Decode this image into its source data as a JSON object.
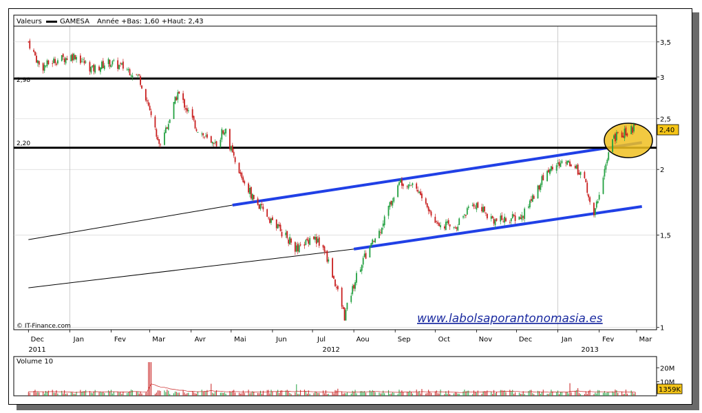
{
  "header": {
    "label": "Valeurs",
    "ticker": "GAMESA",
    "info": "Année +Bas: 1,60 +Haut: 2,43"
  },
  "credit": "© IT-Finance.com",
  "watermark": "www.labolsaporantonomasia.es",
  "volume_label": "Volume 10",
  "colors": {
    "up": "#22a040",
    "down": "#c81e1e",
    "trendline_blue": "#2040e6",
    "level_line": "#000000",
    "highlight_fill": "#f0c020",
    "price_badge": "#f5c518",
    "watermark": "#1a2aa0"
  },
  "chart_data": [
    {
      "type": "candlestick",
      "ticker": "GAMESA",
      "yscale": "log",
      "ylim": [
        0.99,
        3.75
      ],
      "y_ticks": [
        "3,5",
        "3",
        "2,5",
        "2",
        "1,5",
        "1"
      ],
      "x_months": [
        "Dec",
        "Jan",
        "Fev",
        "Mar",
        "Avr",
        "Mai",
        "Jun",
        "Jul",
        "Aou",
        "Sep",
        "Oct",
        "Nov",
        "Dec",
        "Jan",
        "Fev",
        "Mar"
      ],
      "x_years": [
        "2011",
        "2012",
        "2013"
      ],
      "last_price": "2,40",
      "levels": [
        {
          "label": "2,98",
          "value": 2.98
        },
        {
          "label": "2,20",
          "value": 2.2
        }
      ],
      "price_path": [
        [
          "2011-12-01",
          3.5
        ],
        [
          "2011-12-10",
          3.12
        ],
        [
          "2011-12-20",
          3.22
        ],
        [
          "2012-01-05",
          3.3
        ],
        [
          "2012-01-18",
          3.1
        ],
        [
          "2012-01-30",
          3.2
        ],
        [
          "2012-02-12",
          3.12
        ],
        [
          "2012-02-22",
          3.0
        ],
        [
          "2012-03-01",
          2.6
        ],
        [
          "2012-03-08",
          2.22
        ],
        [
          "2012-03-16",
          2.5
        ],
        [
          "2012-03-22",
          2.8
        ],
        [
          "2012-04-05",
          2.4
        ],
        [
          "2012-04-18",
          2.2
        ],
        [
          "2012-04-26",
          2.4
        ],
        [
          "2012-05-05",
          2.0
        ],
        [
          "2012-05-20",
          1.72
        ],
        [
          "2012-06-05",
          1.55
        ],
        [
          "2012-06-20",
          1.4
        ],
        [
          "2012-07-01",
          1.5
        ],
        [
          "2012-07-10",
          1.4
        ],
        [
          "2012-07-25",
          1.05
        ],
        [
          "2012-08-05",
          1.3
        ],
        [
          "2012-08-20",
          1.52
        ],
        [
          "2012-09-05",
          1.9
        ],
        [
          "2012-09-15",
          1.88
        ],
        [
          "2012-09-30",
          1.6
        ],
        [
          "2012-10-15",
          1.55
        ],
        [
          "2012-10-30",
          1.72
        ],
        [
          "2012-11-15",
          1.6
        ],
        [
          "2012-12-05",
          1.62
        ],
        [
          "2012-12-25",
          2.0
        ],
        [
          "2013-01-08",
          2.08
        ],
        [
          "2013-01-20",
          1.95
        ],
        [
          "2013-01-28",
          1.62
        ],
        [
          "2013-02-05",
          2.0
        ],
        [
          "2013-02-12",
          2.3
        ],
        [
          "2013-02-28",
          2.4
        ]
      ],
      "trendlines": [
        {
          "name": "channel-upper",
          "color": "blue",
          "from": [
            "2012-05-02",
            1.71
          ],
          "to": [
            "2013-03-05",
            2.25
          ]
        },
        {
          "name": "channel-lower",
          "color": "blue",
          "from": [
            "2012-08-01",
            1.41
          ],
          "to": [
            "2013-03-05",
            1.7
          ]
        },
        {
          "name": "long-support-upper",
          "color": "black",
          "from": [
            "2011-12-01",
            1.47
          ],
          "to": [
            "2012-05-02",
            1.71
          ]
        },
        {
          "name": "long-support-lower",
          "color": "black",
          "from": [
            "2011-12-01",
            1.19
          ],
          "to": [
            "2012-08-01",
            1.41
          ]
        }
      ]
    },
    {
      "type": "bar",
      "name": "Volume 10",
      "y_ticks": [
        "20M",
        "10M"
      ],
      "last_value": "1359K",
      "typical_volume_m": 3,
      "spike": {
        "date": "2012-03-01",
        "value_m": 24
      }
    }
  ]
}
